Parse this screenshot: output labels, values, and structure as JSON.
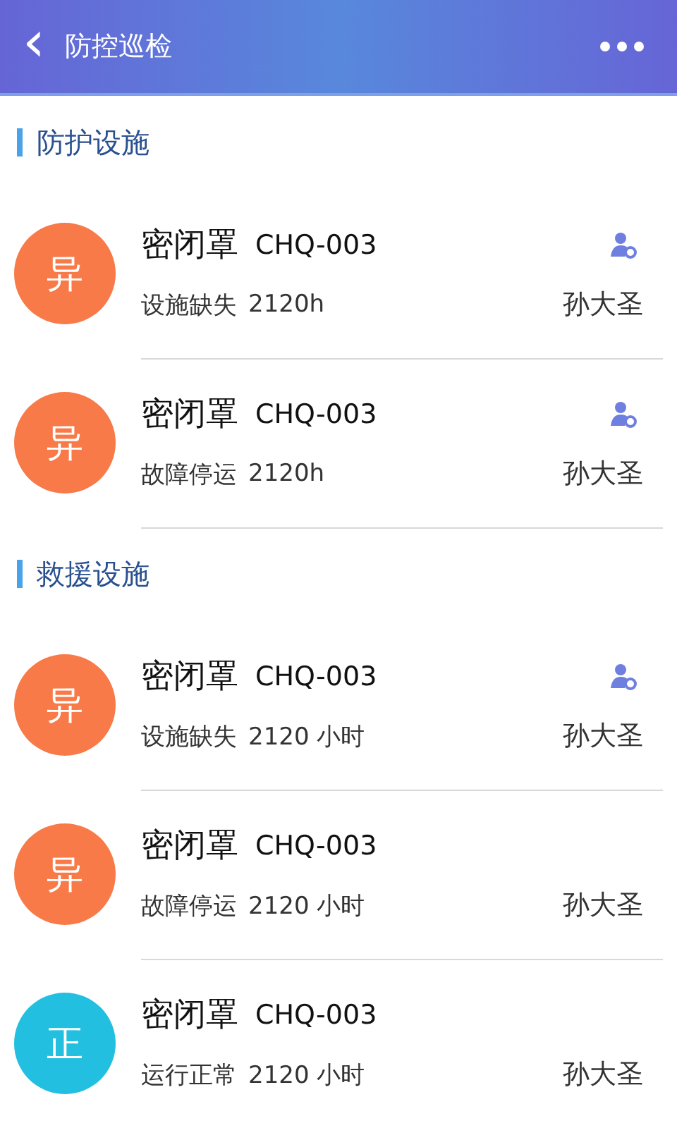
{
  "header": {
    "back_glyph": "‹",
    "title": "防控巡检"
  },
  "sections": [
    {
      "title": "防护设施",
      "items": [
        {
          "badge": "异",
          "color": "#f77a48",
          "name": "密闭罩",
          "code": "CHQ-003",
          "status": "设施缺失",
          "duration": "2120h",
          "person": "孙大圣",
          "assigned": true
        },
        {
          "badge": "异",
          "color": "#f77a48",
          "name": "密闭罩",
          "code": "CHQ-003",
          "status": "故障停运",
          "duration": "2120h",
          "person": "孙大圣",
          "assigned": true
        }
      ]
    },
    {
      "title": "救援设施",
      "items": [
        {
          "badge": "异",
          "color": "#f77a48",
          "name": "密闭罩",
          "code": "CHQ-003",
          "status": "设施缺失",
          "duration": "2120 小时",
          "person": "孙大圣",
          "assigned": true
        },
        {
          "badge": "异",
          "color": "#f77a48",
          "name": "密闭罩",
          "code": "CHQ-003",
          "status": "故障停运",
          "duration": "2120 小时",
          "person": "孙大圣",
          "assigned": false
        },
        {
          "badge": "正",
          "color": "#22bfe0",
          "name": "密闭罩",
          "code": "CHQ-003",
          "status": "运行正常",
          "duration": "2120 小时",
          "person": "孙大圣",
          "assigned": false
        }
      ]
    }
  ]
}
